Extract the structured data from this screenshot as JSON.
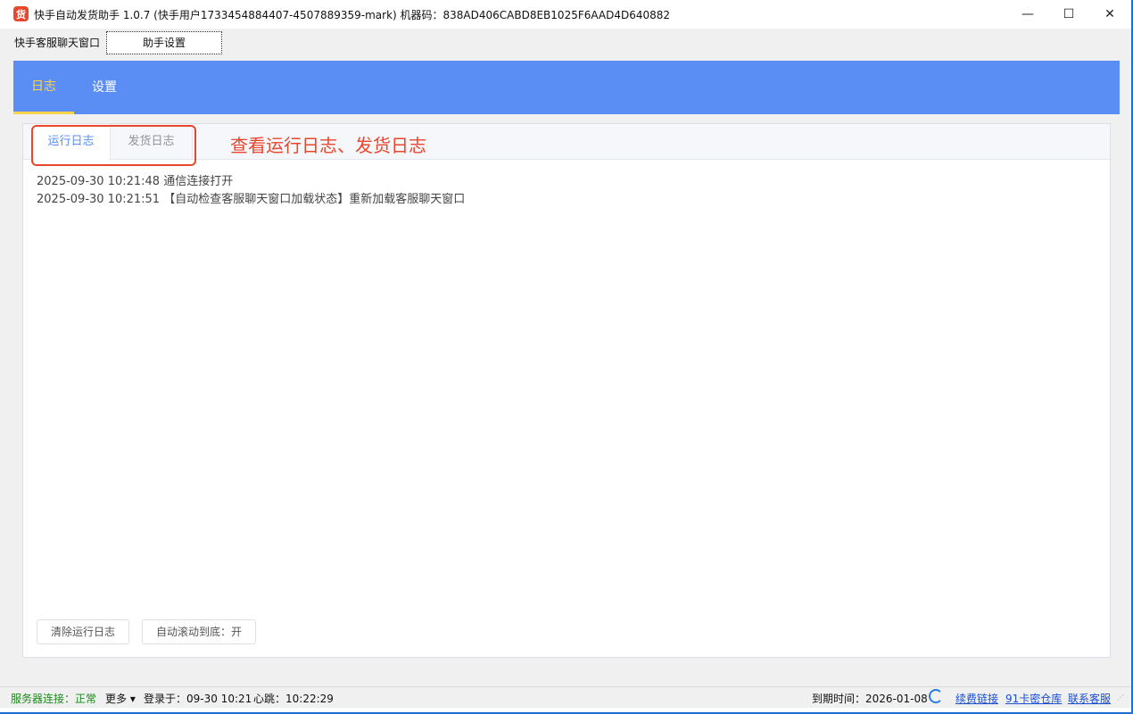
{
  "window": {
    "app_icon_glyph": "货",
    "title": "快手自动发货助手 1.0.7 (快手用户1733454884407-4507889359-mark) 机器码：838AD406CABD8EB1025F6AAD4D640882",
    "minimize": "—",
    "maximize": "☐",
    "close": "✕"
  },
  "tabs": {
    "chat_window": "快手客服聊天窗口",
    "assistant_settings": "助手设置"
  },
  "nav": {
    "log": "日志",
    "settings": "设置"
  },
  "log_panel": {
    "tabs": {
      "run_log": "运行日志",
      "ship_log": "发货日志"
    },
    "annotation": "查看运行日志、发货日志",
    "lines": [
      "2025-09-30 10:21:48 通信连接打开",
      "2025-09-30 10:21:51 【自动检查客服聊天窗口加载状态】重新加载客服聊天窗口"
    ],
    "clear_button": "清除运行日志",
    "autoscroll_button": "自动滚动到底：开"
  },
  "statusbar": {
    "server_label": "服务器连接：",
    "server_status": "正常",
    "more": "更多 ▾",
    "login": "登录于：09-30 10:21",
    "heartbeat": "心跳：10:22:29",
    "expiry": "到期时间：2026-01-08",
    "renew_link": "续费链接",
    "card_link": "91卡密仓库",
    "support_link": "联系客服"
  },
  "colors": {
    "accent_blue": "#5b8ef5",
    "active_yellow": "#ffd24a",
    "annotation_red": "#e8462d",
    "status_green": "#1a8a1a"
  }
}
